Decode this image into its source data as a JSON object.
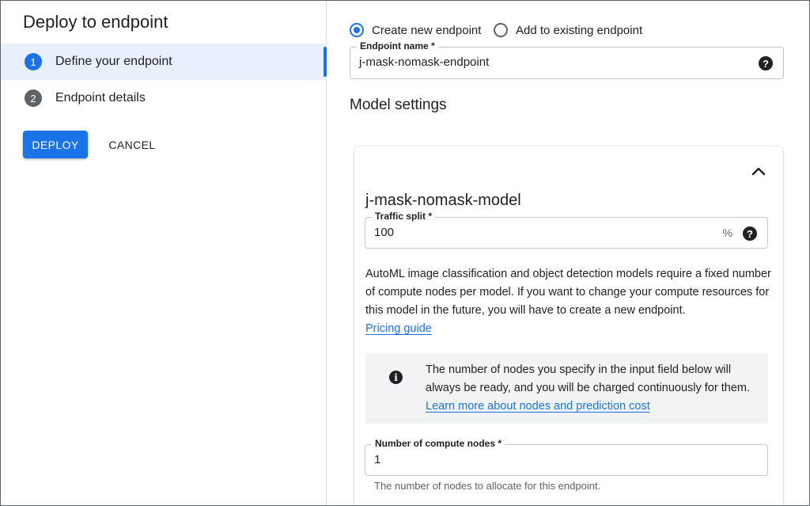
{
  "panel": {
    "title": "Deploy to endpoint",
    "steps": [
      {
        "number": "1",
        "label": "Define your endpoint",
        "active": true
      },
      {
        "number": "2",
        "label": "Endpoint details",
        "active": false
      }
    ],
    "deploy_label": "DEPLOY",
    "cancel_label": "CANCEL"
  },
  "endpoint": {
    "radio_new": "Create new endpoint",
    "radio_existing": "Add to existing endpoint",
    "selected": "new",
    "name_label": "Endpoint name *",
    "name_value": "j-mask-nomask-endpoint"
  },
  "model_settings": {
    "title": "Model settings",
    "model_name": "j-mask-nomask-model",
    "traffic_label": "Traffic split *",
    "traffic_value": "100",
    "traffic_unit": "%",
    "description": "AutoML image classification and object detection models require a fixed number of compute nodes per model. If you want to change your compute resources for this model in the future, you will have to create a new endpoint.",
    "pricing_link": "Pricing guide",
    "info_text": "The number of nodes you specify in the input field below will always be ready, and you will be charged continuously for them.",
    "info_link": "Learn more about nodes and prediction cost",
    "nodes_label": "Number of compute nodes *",
    "nodes_value": "1",
    "nodes_hint": "The number of nodes to allocate for this endpoint."
  },
  "icons": {
    "help": "help-icon",
    "info": "info-icon",
    "collapse": "chevron-up-icon"
  },
  "colors": {
    "accent": "#1a73e8",
    "active_step_bg": "#e8f0fe",
    "info_bg": "#f1f3f4"
  }
}
